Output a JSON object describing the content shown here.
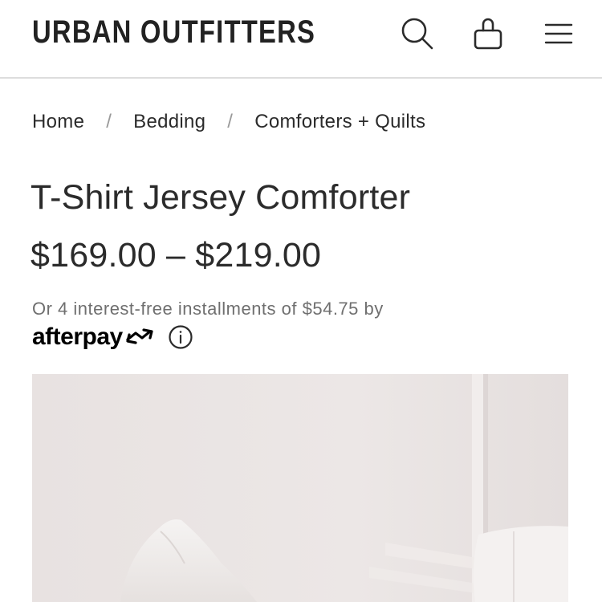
{
  "header": {
    "brand": "URBAN OUTFITTERS",
    "icons": [
      "search-icon",
      "shopping-bag-icon",
      "hamburger-menu-icon"
    ]
  },
  "breadcrumb": {
    "items": [
      "Home",
      "Bedding",
      "Comforters + Quilts"
    ],
    "separator": "/"
  },
  "product": {
    "title": "T-Shirt Jersey Comforter",
    "price": "$169.00 – $219.00",
    "installments_text": "Or 4 interest-free installments of $54.75 by",
    "afterpay_label": "afterpay"
  },
  "colors": {
    "text": "#2b2b2b",
    "muted": "#6f6f6f",
    "divider": "#dddddd",
    "image_bg": "#e9e3e2"
  }
}
